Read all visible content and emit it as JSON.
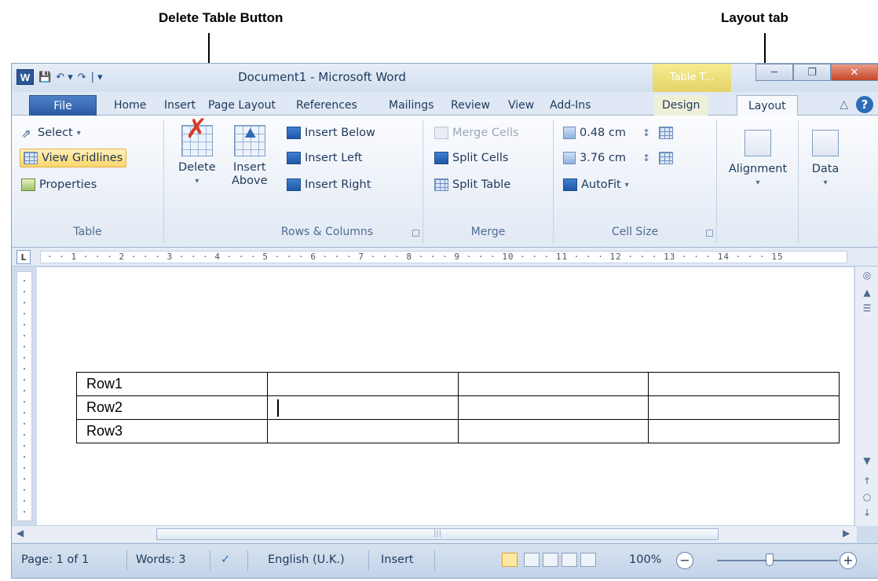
{
  "callouts": {
    "delete_table": "Delete Table Button",
    "layout_tab": "Layout tab"
  },
  "titlebar": {
    "app_icon": "W",
    "title": "Document1 - Microsoft Word",
    "contextual": "Table T...",
    "qat_icons": [
      "save-icon",
      "undo-icon",
      "redo-icon",
      "customize-icon"
    ]
  },
  "tabs": [
    {
      "label": "File"
    },
    {
      "label": "Home"
    },
    {
      "label": "Insert"
    },
    {
      "label": "Page Layout"
    },
    {
      "label": "References"
    },
    {
      "label": "Mailings"
    },
    {
      "label": "Review"
    },
    {
      "label": "View"
    },
    {
      "label": "Add-Ins"
    },
    {
      "label": "Design"
    },
    {
      "label": "Layout"
    }
  ],
  "ribbon": {
    "table": {
      "label": "Table",
      "select": "Select",
      "view_gridlines": "View Gridlines",
      "properties": "Properties"
    },
    "delete": {
      "label": "Delete"
    },
    "rows_columns": {
      "label": "Rows & Columns",
      "insert_above_1": "Insert",
      "insert_above_2": "Above",
      "insert_below": "Insert Below",
      "insert_left": "Insert Left",
      "insert_right": "Insert Right"
    },
    "merge": {
      "label": "Merge",
      "merge_cells": "Merge Cells",
      "split_cells": "Split Cells",
      "split_table": "Split Table"
    },
    "cell_size": {
      "label": "Cell Size",
      "height": "0.48 cm",
      "width": "3.76 cm",
      "autofit": "AutoFit"
    },
    "alignment": {
      "label": "Alignment"
    },
    "data": {
      "label": "Data"
    }
  },
  "ruler": {
    "box": "L",
    "marks": "· · 1 · · · 2 · · · 3 · · · 4 · · · 5 · · · 6 · · · 7 · · · 8 · · · 9 · · · 10 · · · 11 · · · 12 · · · 13 · · · 14 · · · 15"
  },
  "document": {
    "rows": [
      [
        "Row1",
        "",
        "",
        ""
      ],
      [
        "Row2",
        "",
        "",
        ""
      ],
      [
        "Row3",
        "",
        "",
        ""
      ]
    ]
  },
  "status": {
    "page": "Page: 1 of 1",
    "words": "Words: 3",
    "language": "English (U.K.)",
    "mode": "Insert",
    "zoom": "100%"
  }
}
